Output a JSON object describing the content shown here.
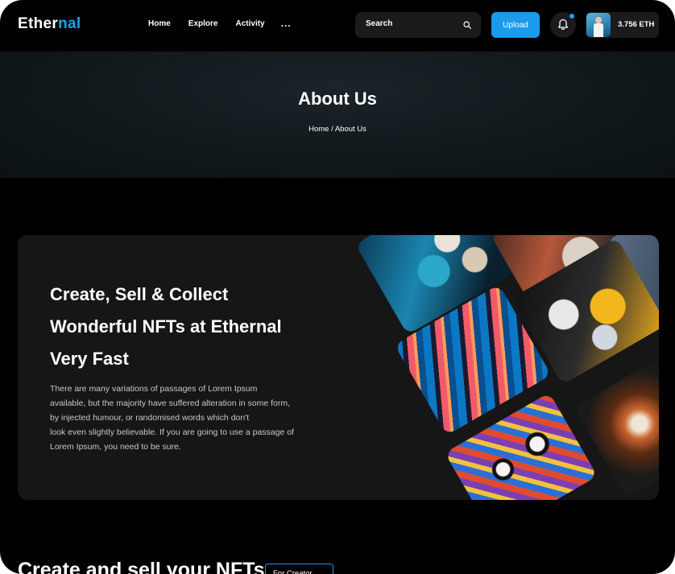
{
  "brand": {
    "logo_main": "Ether",
    "logo_accent": "nal",
    "accent_color": "#1fa2f1"
  },
  "nav": {
    "items": [
      {
        "label": "Home"
      },
      {
        "label": "Explore"
      },
      {
        "label": "Activity"
      }
    ],
    "more_label": "..."
  },
  "search": {
    "placeholder": "Search",
    "icon": "search-icon"
  },
  "upload": {
    "label": "Upload"
  },
  "notifications": {
    "icon": "bell-icon"
  },
  "wallet": {
    "balance": "3.756 ETH"
  },
  "banner": {
    "title": "About Us",
    "breadcrumb": "Home / About Us"
  },
  "hero": {
    "heading_lines": [
      "Create, Sell & Collect",
      "Wonderful NFTs at Ethernal",
      "Very Fast"
    ],
    "body_lines": [
      "There are many variations of passages of Lorem Ipsum",
      "available, but the majority have suffered alteration in some form,",
      "by injected humour, or randomised words which don't",
      "look even slightly believable. If you are going to use a passage of",
      "Lorem Ipsum, you need to be sure."
    ]
  },
  "section": {
    "title": "Create and sell your NFTs",
    "filter_label": "For Creator"
  }
}
